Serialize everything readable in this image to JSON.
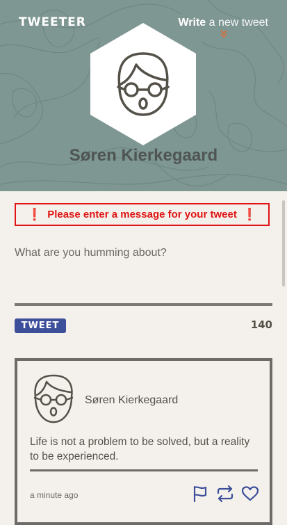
{
  "nav": {
    "brand": "TWEETER",
    "compose_bold": "Write",
    "compose_rest": " a new tweet"
  },
  "profile": {
    "name": "Søren Kierkegaard",
    "avatar_icon": "person-with-glasses-icon"
  },
  "composer": {
    "error_message": "Please enter a message for your tweet",
    "error_icon": "exclamation-icon",
    "placeholder": "What are you humming about?",
    "value": "",
    "submit_label": "TWEET",
    "char_counter": "140"
  },
  "tweets": [
    {
      "author": "Søren Kierkegaard",
      "text": "Life is not a problem to be solved, but a reality to be experienced.",
      "time": "a minute ago",
      "actions": [
        "flag-icon",
        "retweet-icon",
        "heart-icon"
      ]
    }
  ],
  "colors": {
    "header_bg": "#7f9793",
    "page_bg": "#f4f1ec",
    "accent": "#3d4f9a",
    "error": "#e01414",
    "text": "#545149",
    "chevron": "#d2713f"
  }
}
